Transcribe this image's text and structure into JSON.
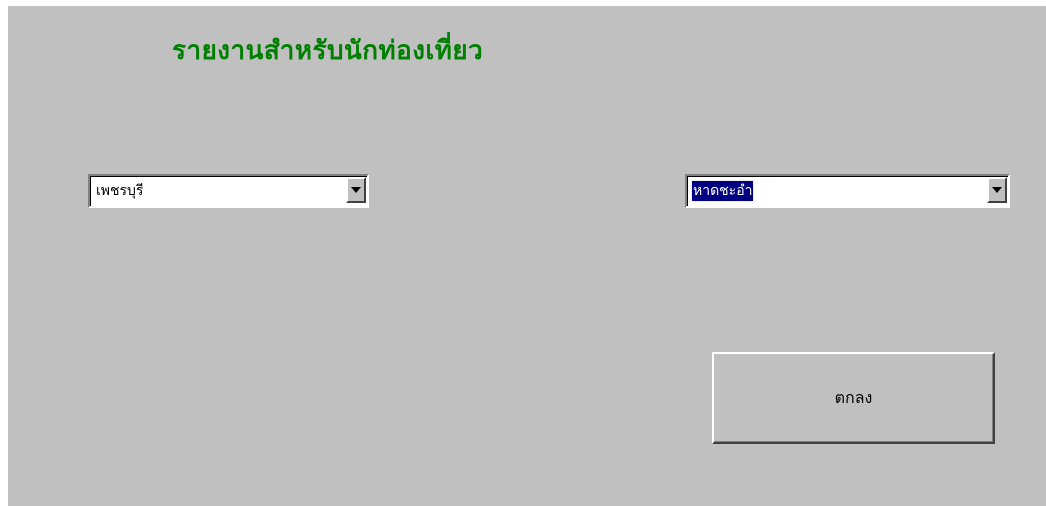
{
  "form": {
    "title": "รายงานสำหรับนักท่องเที่ยว",
    "background_color": "#c0c0c0",
    "title_color": "#008000"
  },
  "province_combo": {
    "value": "เพชรบุรี"
  },
  "place_combo": {
    "value": "หาดชะอำ",
    "selected_highlight_color": "#000080"
  },
  "ok_button": {
    "label": "ตกลง"
  }
}
